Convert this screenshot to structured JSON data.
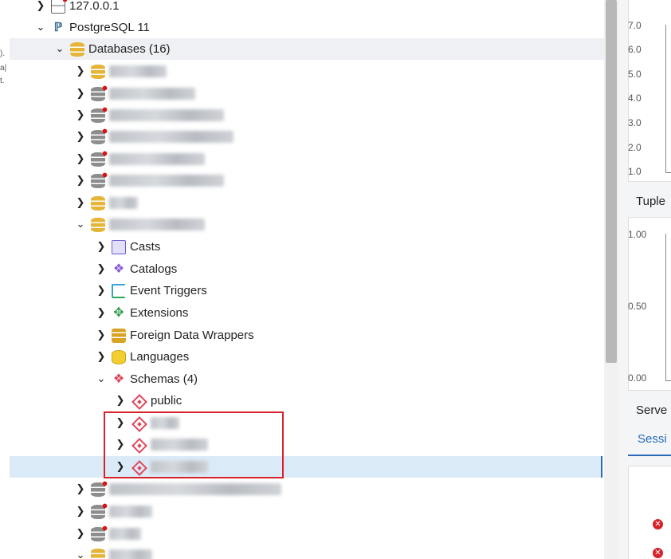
{
  "tree": {
    "server_host": "127.0.0.1",
    "server_name": "PostgreSQL 11",
    "databases_label": "Databases (16)",
    "db_children": {
      "casts": "Casts",
      "catalogs": "Catalogs",
      "event_triggers": "Event Triggers",
      "extensions": "Extensions",
      "foreign_data_wrappers": "Foreign Data Wrappers",
      "languages": "Languages",
      "schemas": "Schemas (4)"
    },
    "schema_public": "public"
  },
  "right_panel": {
    "chart1_ticks": [
      "7.0",
      "6.0",
      "5.0",
      "4.0",
      "3.0",
      "2.0",
      "1.0"
    ],
    "tuples_title": "Tuple",
    "chart2_ticks": [
      "1.00",
      "0.50",
      "0.00"
    ],
    "server_activity_title": "Serve",
    "sessions_tab": "Sessi",
    "legend_colors": [
      "#2f8ed8",
      "#b6c92a",
      "#d33a3a"
    ]
  },
  "icons": {
    "arrow_expanded": "▾",
    "arrow_collapsed": "›",
    "close": "✕"
  }
}
